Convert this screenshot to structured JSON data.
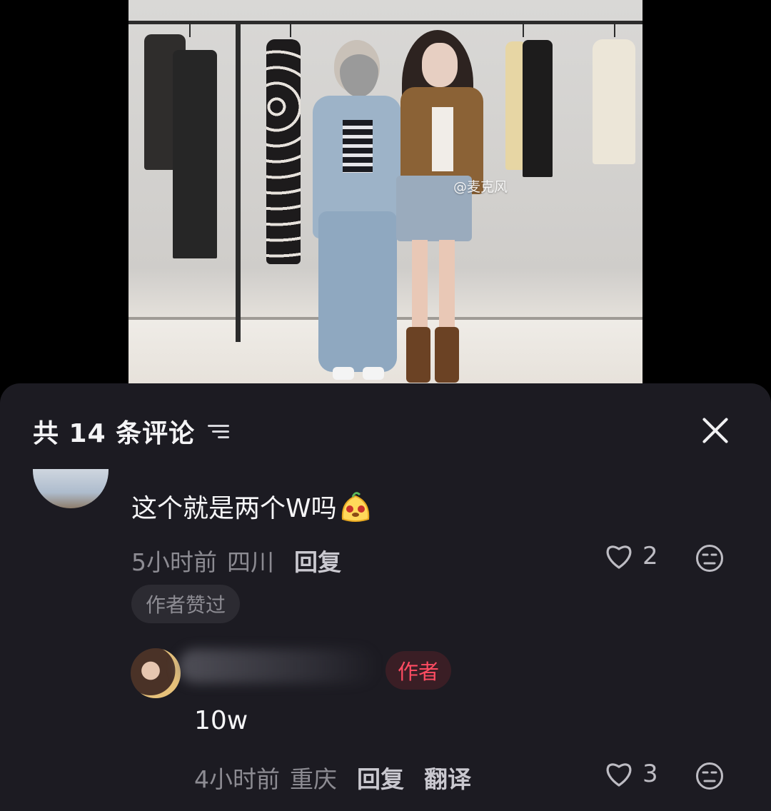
{
  "photo": {
    "watermark": "@麦克风"
  },
  "comments_panel": {
    "title": "共 14 条评论",
    "comments": [
      {
        "text": "这个就是两个W吗",
        "emoji": "pudding-emoji",
        "time": "5小时前",
        "location": "四川",
        "reply_label": "回复",
        "likes": "2",
        "badge": "作者赞过"
      }
    ],
    "reply": {
      "author_tag": "作者",
      "text": "10w",
      "time": "4小时前",
      "location": "重庆",
      "reply_label": "回复",
      "translate_label": "翻译",
      "likes": "3"
    }
  },
  "colors": {
    "sheet_bg": "#1c1b22",
    "author_tag": "#ff4c62",
    "muted_text": "#8c8b92"
  }
}
